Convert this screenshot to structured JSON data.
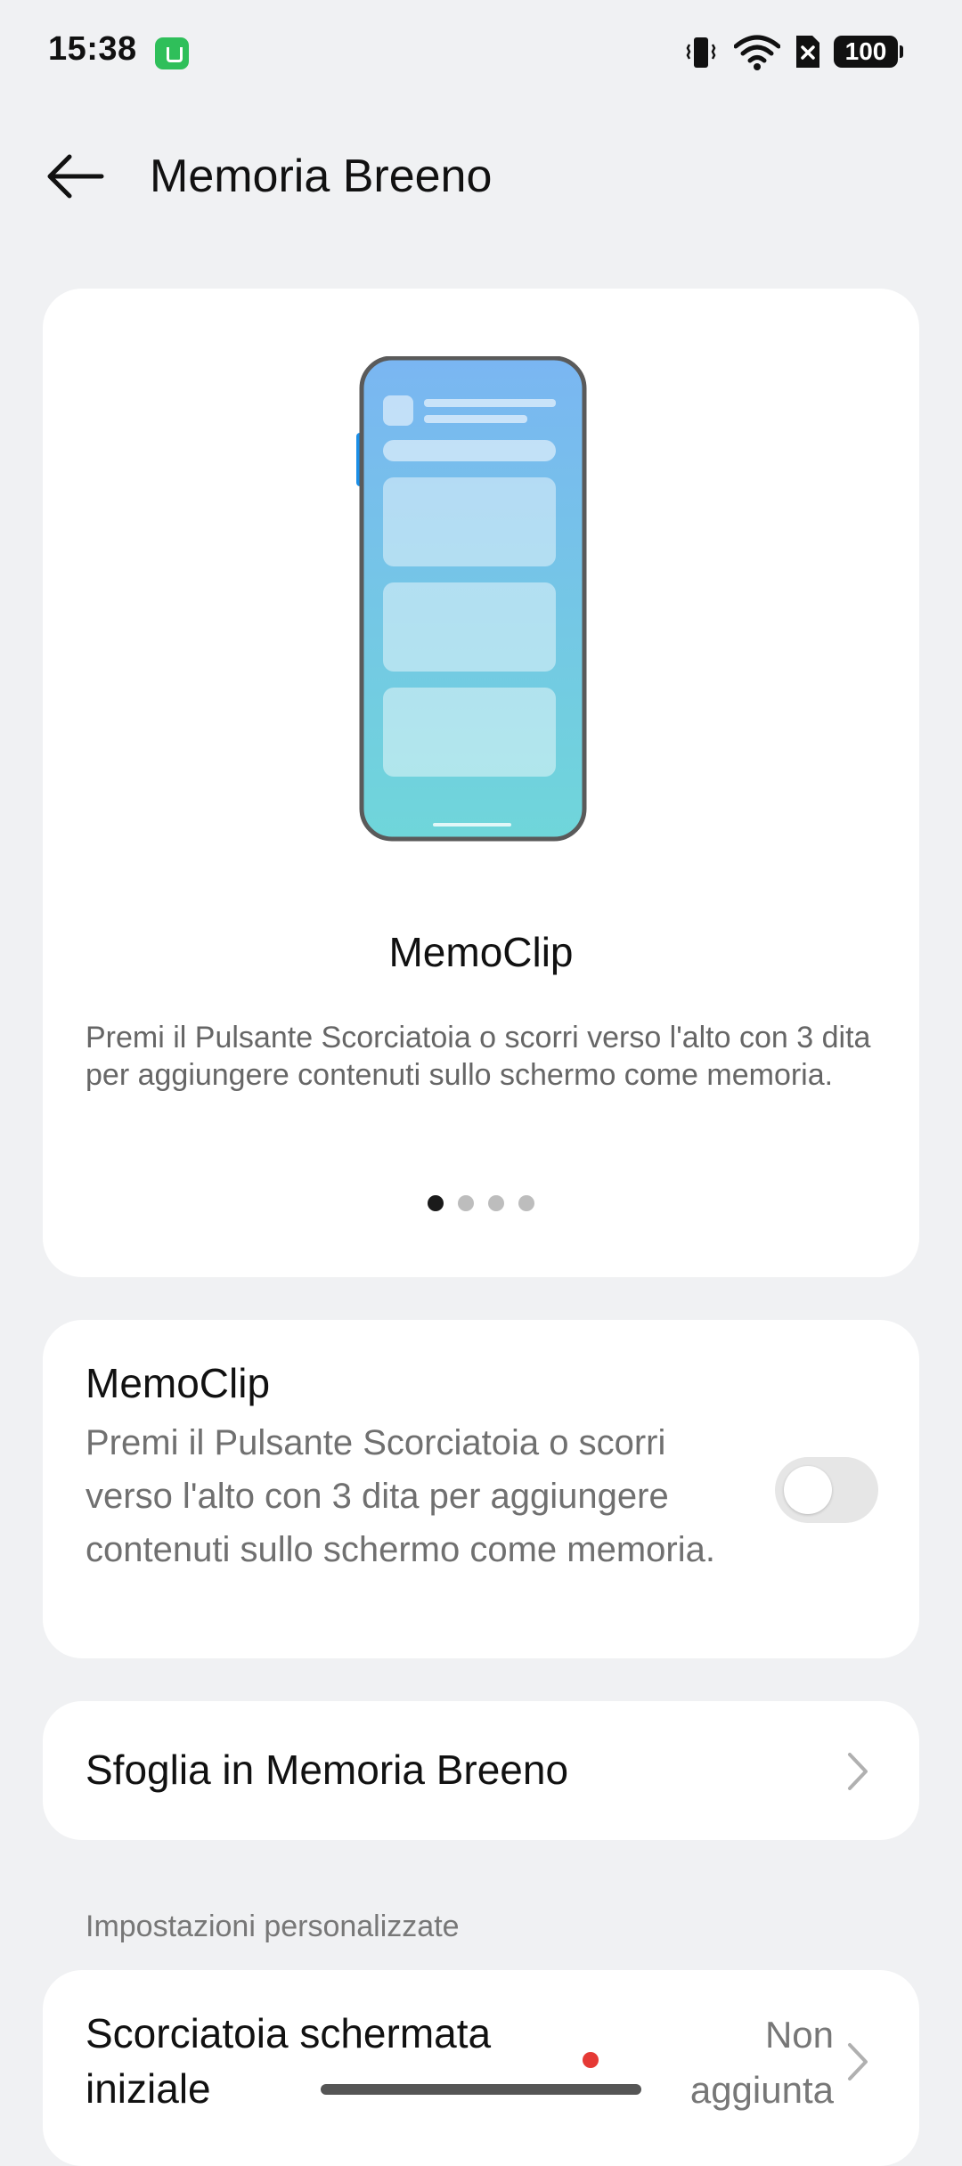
{
  "status_bar": {
    "time": "15:38",
    "battery": "100",
    "icons": [
      "notification-app-icon",
      "vibrate-icon",
      "wifi-icon",
      "sim-blocked-icon",
      "battery-icon"
    ]
  },
  "header": {
    "title": "Memoria Breeno",
    "back_icon": "arrow-left-icon"
  },
  "carousel": {
    "title": "MemoClip",
    "description": "Premi il Pulsante Scorciatoia o scorri verso l'alto con 3 dita per aggiungere contenuti sullo schermo come memoria.",
    "page_count": 4,
    "active_page": 1
  },
  "memoclip_toggle": {
    "title": "MemoClip",
    "description": "Premi il Pulsante Scorciatoia o scorri verso l'alto con 3 dita per aggiungere contenuti sullo schermo come memoria.",
    "enabled": false
  },
  "browse": {
    "label": "Sfoglia in Memoria Breeno"
  },
  "section_header": "Impostazioni personalizzate",
  "shortcut_row": {
    "label": "Scorciatoia schermata iniziale",
    "value": "Non aggiunta"
  },
  "colors": {
    "background": "#f0f1f3",
    "card": "#ffffff",
    "phone_gradient_top": "#7ab6f2",
    "phone_gradient_bottom": "#6fd6da",
    "side_button": "#1a8ee6",
    "record_dot": "#e53935"
  }
}
